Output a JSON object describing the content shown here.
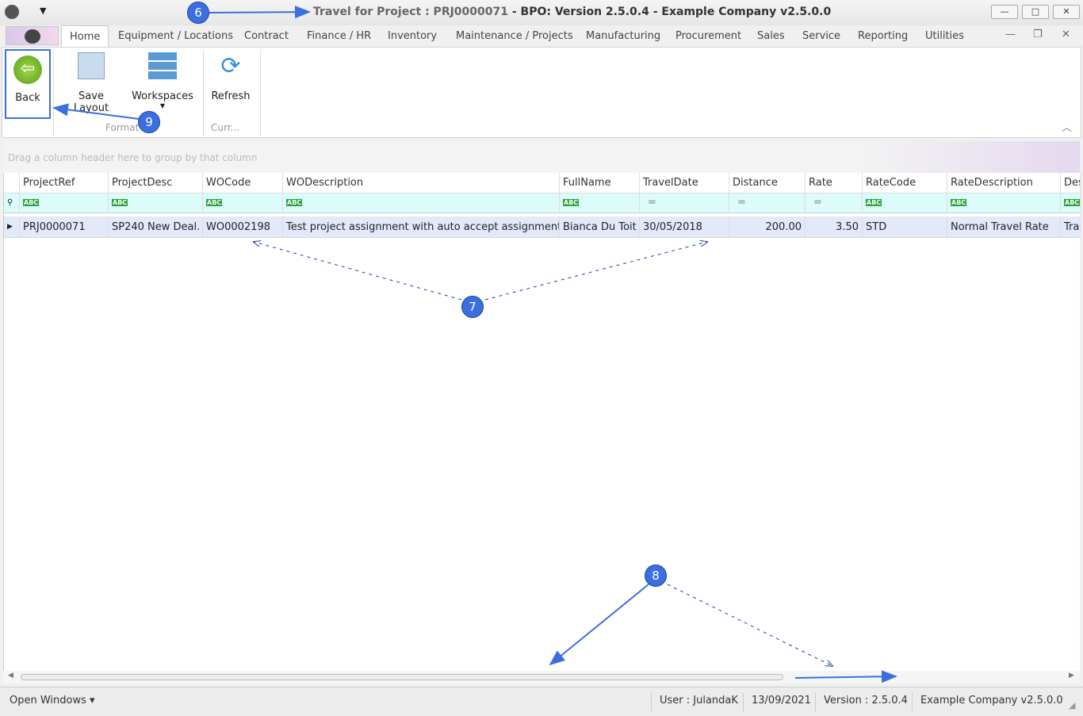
{
  "window": {
    "title_prefix": "Travel for Project : PRJ0000071",
    "title_rest": " - BPO: Version 2.5.0.4 - Example Company v2.5.0.0",
    "min": "—",
    "max": "□",
    "close": "✕"
  },
  "tabs": [
    "Home",
    "Equipment / Locations",
    "Contract",
    "Finance / HR",
    "Inventory",
    "Maintenance / Projects",
    "Manufacturing",
    "Procurement",
    "Sales",
    "Service",
    "Reporting",
    "Utilities"
  ],
  "ribbon": {
    "back": "Back",
    "save_layout": "Save Layout",
    "workspaces": "Workspaces",
    "refresh": "Refresh",
    "group_format": "Format",
    "group_curr": "Curr..."
  },
  "grid": {
    "group_hint": "Drag a column header here to group by that column",
    "columns": [
      "ProjectRef",
      "ProjectDesc",
      "WOCode",
      "WODescription",
      "FullName",
      "TravelDate",
      "Distance",
      "Rate",
      "RateCode",
      "RateDescription",
      "Des"
    ],
    "filter_abc": "ABC",
    "filter_eq": "=",
    "rows": [
      [
        "PRJ0000071",
        "SP240 New Deal.",
        "WO0002198",
        "Test project assignment with auto accept assignment on",
        "Bianca Du Toit",
        "30/05/2018",
        "200.00",
        "3.50",
        "STD",
        "Normal Travel Rate",
        "Tra"
      ]
    ]
  },
  "status": {
    "open_windows": "Open Windows ▾",
    "user": "User : JulandaK",
    "date": "13/09/2021",
    "version": "Version : 2.5.0.4",
    "company": "Example Company v2.5.0.0"
  },
  "annotations": [
    "6",
    "7",
    "8",
    "9"
  ]
}
